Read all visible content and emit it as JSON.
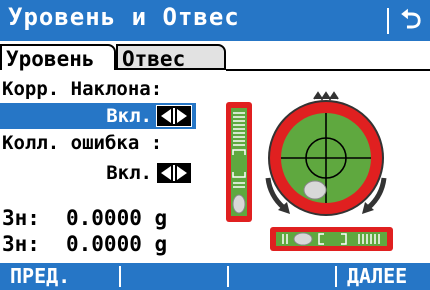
{
  "header": {
    "title": "Уровень и Отвес",
    "back_icon": "return-arrow-icon"
  },
  "tabs": [
    {
      "label": "Уровень",
      "active": true
    },
    {
      "label": "Отвес",
      "active": false
    }
  ],
  "settings": {
    "tilt_label": "Корр. Наклона:",
    "tilt_value": "Вкл.",
    "coll_label": "Колл. ошибка  :",
    "coll_value": "Вкл."
  },
  "measurements": [
    {
      "label": "Зн:",
      "value": "0.0000 g"
    },
    {
      "label": "Зн:",
      "value": "0.0000 g"
    }
  ],
  "softkeys": {
    "f1": "ПРЕД.",
    "f2": "",
    "f3": "",
    "f4": "ДАЛЕЕ"
  },
  "colors": {
    "accent": "#2676c6",
    "bubble_ring": "#e02020",
    "bubble_field": "#5fa83f"
  }
}
